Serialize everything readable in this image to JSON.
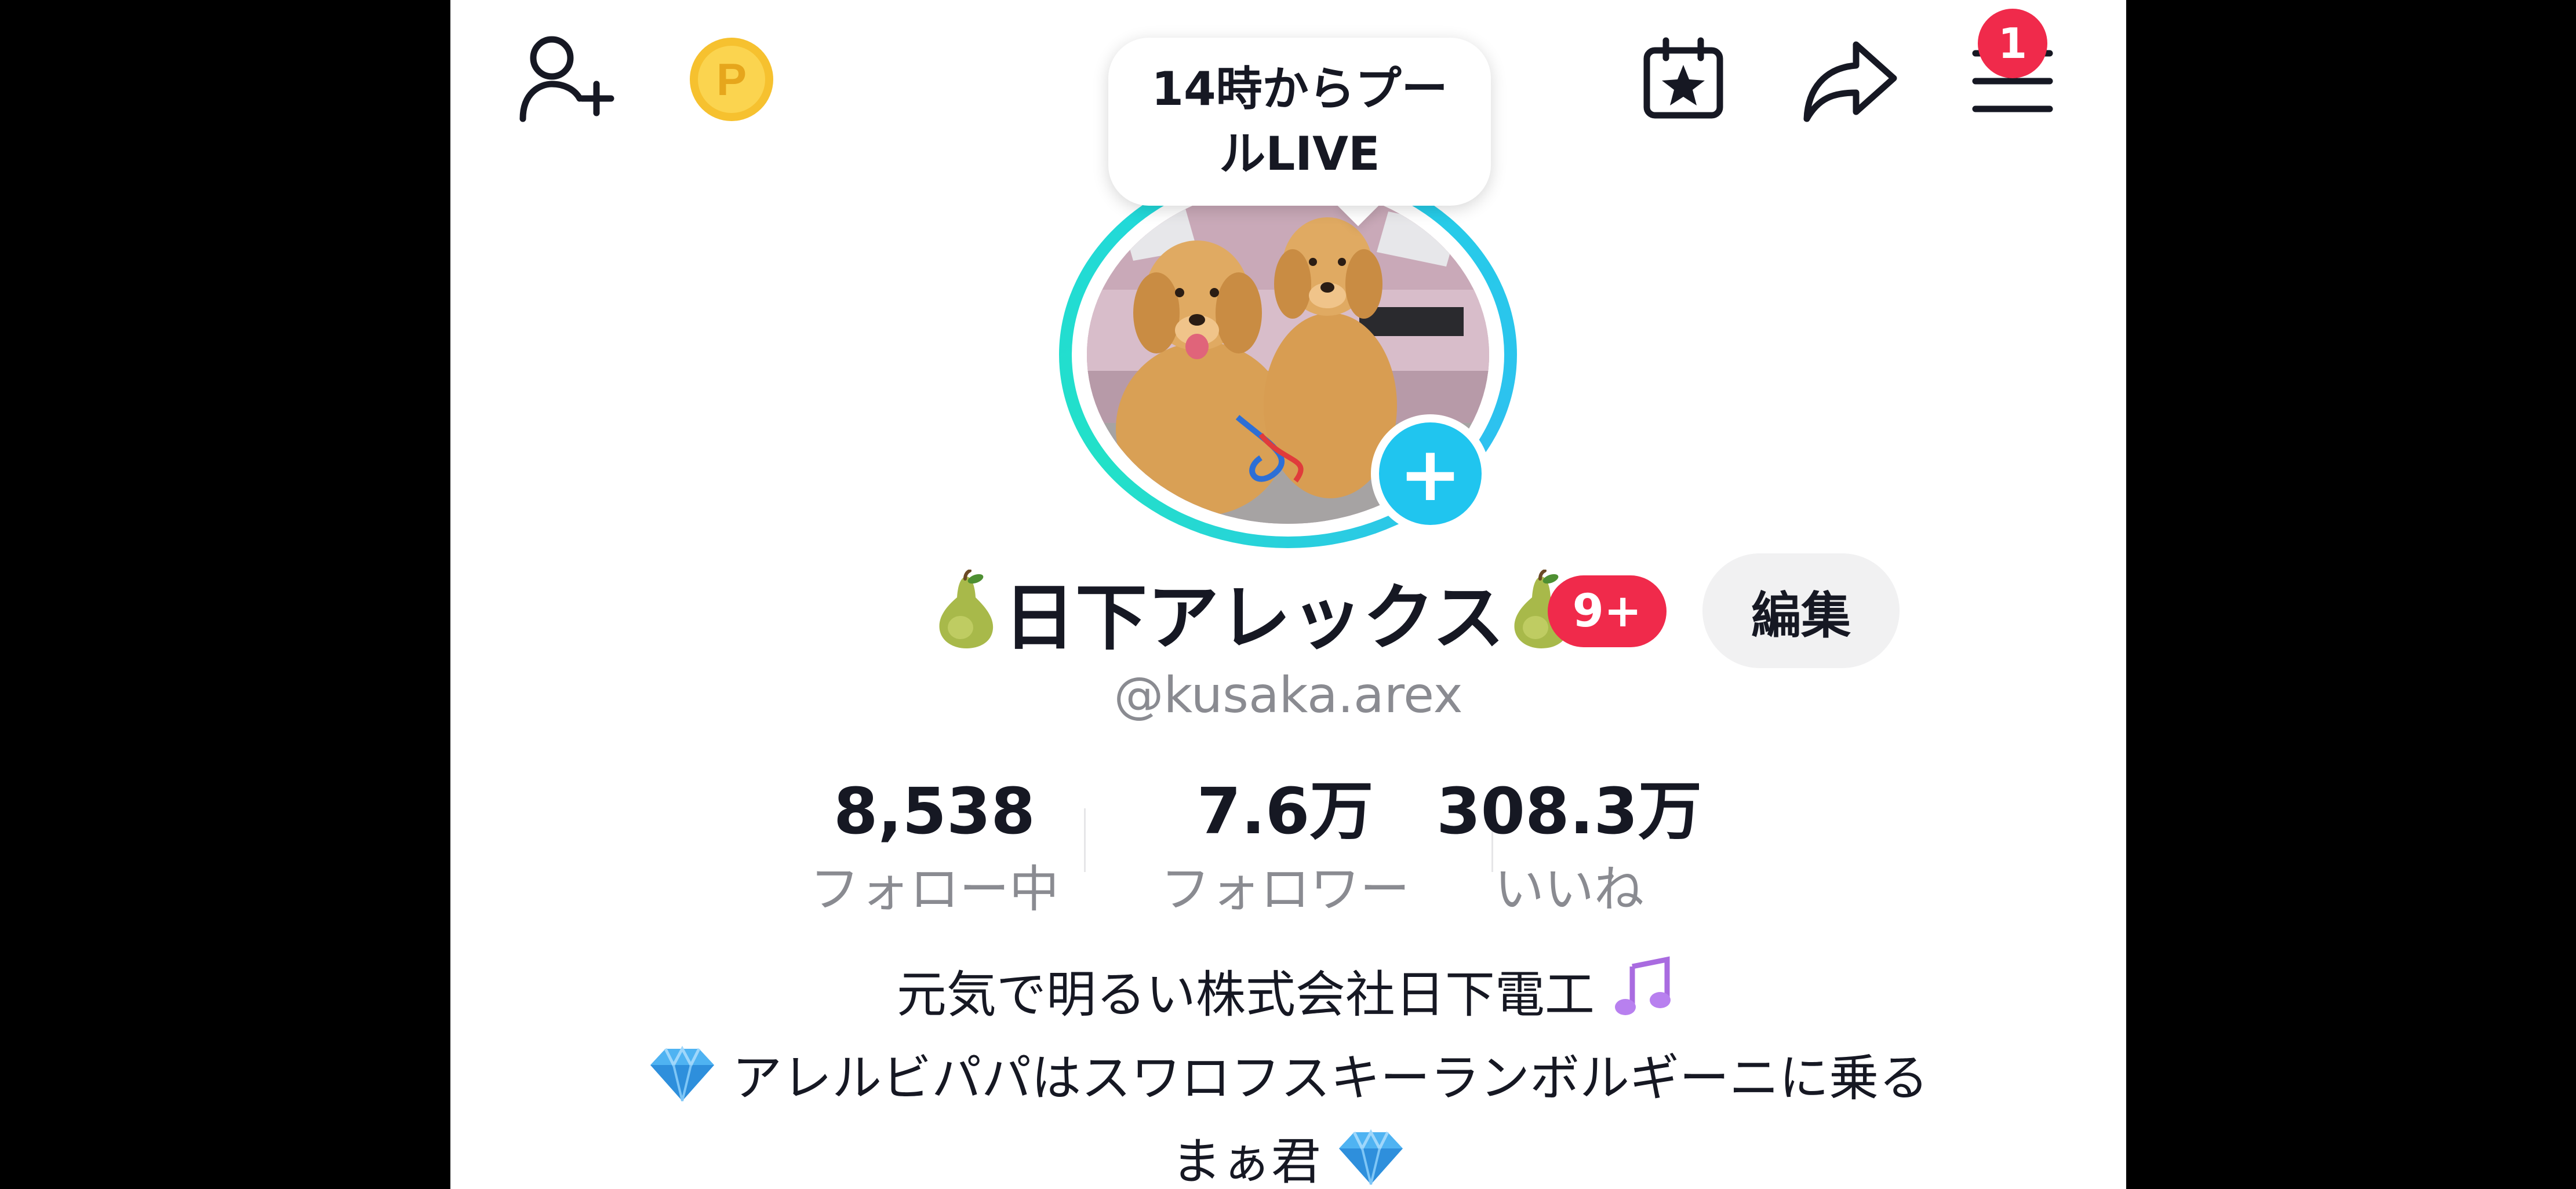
{
  "header": {
    "notification_count": "1"
  },
  "live_bubble": {
    "line1": "14時からプー",
    "line2": "ルLIVE"
  },
  "profile": {
    "display_name": "日下アレックス",
    "badge": "9+",
    "edit_label": "編集",
    "username": "@kusaka.arex"
  },
  "stats": [
    {
      "value": "8,538",
      "label": "フォロー中"
    },
    {
      "value": "7.6万",
      "label": "フォロワー"
    },
    {
      "value": "308.3万",
      "label": "いいね"
    }
  ],
  "bio": {
    "line1": "元気で明るい株式会社日下電工",
    "line2": "アレルビパパはスワロフスキーランボルギーニに乗る",
    "line3": "まぁ君"
  },
  "colors": {
    "accent_red": "#f02a4b",
    "accent_cyan": "#20c5ef",
    "gold_coin": "#f6c12f"
  }
}
